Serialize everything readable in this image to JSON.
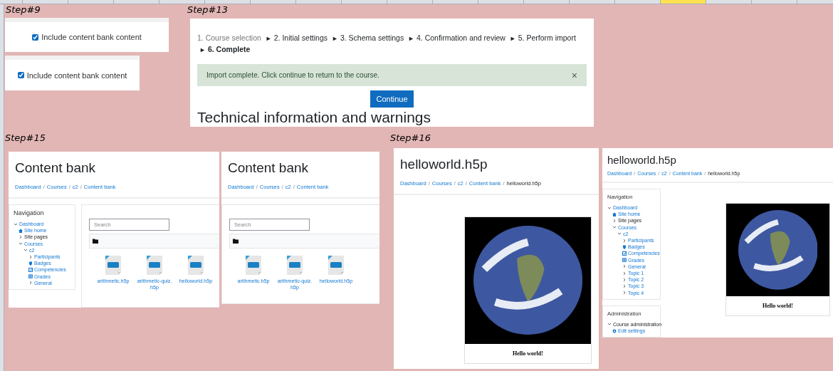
{
  "sheet": {
    "columns": [
      {
        "selected": false
      },
      {
        "selected": false
      },
      {
        "selected": false
      },
      {
        "selected": false
      },
      {
        "selected": false
      },
      {
        "selected": false
      },
      {
        "selected": false
      },
      {
        "selected": false
      },
      {
        "selected": false
      },
      {
        "selected": false
      },
      {
        "selected": false
      },
      {
        "selected": false
      },
      {
        "selected": false
      },
      {
        "selected": false
      },
      {
        "selected": false
      },
      {
        "selected": true
      },
      {
        "selected": false
      },
      {
        "selected": false
      }
    ]
  },
  "step9": {
    "label": "Step#9",
    "checkboxes": [
      {
        "label": "Include content bank content",
        "checked": true
      },
      {
        "label": "Include content bank content",
        "checked": true
      }
    ]
  },
  "step13": {
    "label": "Step#13",
    "separator": "►",
    "progress": [
      {
        "label": "1. Course selection",
        "kind": "done"
      },
      {
        "label": "2. Initial settings",
        "kind": "step"
      },
      {
        "label": "3. Schema settings",
        "kind": "step"
      },
      {
        "label": "4. Confirmation and review",
        "kind": "step"
      },
      {
        "label": "5. Perform import",
        "kind": "step"
      },
      {
        "label": "6. Complete",
        "kind": "current"
      }
    ],
    "alert": {
      "text": "Import complete. Click continue to return to the course.",
      "close": "×"
    },
    "button": "Continue",
    "heading": "Technical information and warnings"
  },
  "step15": {
    "label": "Step#15",
    "separator": "/",
    "pages": [
      {
        "title": "Content bank",
        "breadcrumb": [
          {
            "label": "Dashboard",
            "link": true
          },
          {
            "label": "Courses",
            "link": true
          },
          {
            "label": "c2",
            "link": true
          },
          {
            "label": "Content bank",
            "link": true
          }
        ],
        "navigation": {
          "title": "Navigation",
          "items": [
            {
              "label": "Dashboard",
              "kind": "branch",
              "expanded": true,
              "link": true,
              "children": [
                {
                  "label": "Site home",
                  "kind": "home",
                  "link": true
                },
                {
                  "label": "Site pages",
                  "kind": "branch",
                  "expanded": false,
                  "link": false
                },
                {
                  "label": "Courses",
                  "kind": "branch",
                  "expanded": true,
                  "link": true,
                  "children": [
                    {
                      "label": "c2",
                      "kind": "branch",
                      "expanded": true,
                      "link": true,
                      "children": [
                        {
                          "label": "Participants",
                          "kind": "branch",
                          "expanded": false,
                          "link": true
                        },
                        {
                          "label": "Badges",
                          "kind": "shield",
                          "link": true
                        },
                        {
                          "label": "Competencies",
                          "kind": "check",
                          "link": true
                        },
                        {
                          "label": "Grades",
                          "kind": "table",
                          "link": true
                        },
                        {
                          "label": "General",
                          "kind": "branch",
                          "expanded": false,
                          "link": true
                        }
                      ]
                    }
                  ]
                }
              ]
            }
          ]
        },
        "search_placeholder": "Search",
        "files": [
          "arithmetic.h5p",
          "arithmetic-quiz.h5p",
          "helloworld.h5p"
        ]
      },
      {
        "title": "Content bank",
        "breadcrumb": [
          {
            "label": "Dashboard",
            "link": true
          },
          {
            "label": "Courses",
            "link": true
          },
          {
            "label": "c2",
            "link": true
          },
          {
            "label": "Content bank",
            "link": true
          }
        ],
        "search_placeholder": "Search",
        "files": [
          "arithmetic.h5p",
          "arithmetic-quiz.h5p",
          "helloworld.h5p"
        ]
      }
    ]
  },
  "step16": {
    "label": "Step#16",
    "separator": "/",
    "pages": [
      {
        "title": "helloworld.h5p",
        "breadcrumb": [
          {
            "label": "Dashboard",
            "link": true
          },
          {
            "label": "Courses",
            "link": true
          },
          {
            "label": "c2",
            "link": true
          },
          {
            "label": "Content bank",
            "link": true
          },
          {
            "label": "helloworld.h5p",
            "link": false
          }
        ],
        "caption": "Hello world!"
      },
      {
        "title": "helloworld.h5p",
        "breadcrumb": [
          {
            "label": "Dashboard",
            "link": true
          },
          {
            "label": "Courses",
            "link": true
          },
          {
            "label": "c2",
            "link": true
          },
          {
            "label": "Content bank",
            "link": true
          },
          {
            "label": "helloworld.h5p",
            "link": false
          }
        ],
        "navigation": {
          "title": "Navigation",
          "items": [
            {
              "label": "Dashboard",
              "kind": "branch",
              "expanded": true,
              "link": true,
              "children": [
                {
                  "label": "Site home",
                  "kind": "home",
                  "link": true
                },
                {
                  "label": "Site pages",
                  "kind": "branch",
                  "expanded": false,
                  "link": false
                },
                {
                  "label": "Courses",
                  "kind": "branch",
                  "expanded": true,
                  "link": true,
                  "children": [
                    {
                      "label": "c2",
                      "kind": "branch",
                      "expanded": true,
                      "link": true,
                      "children": [
                        {
                          "label": "Participants",
                          "kind": "branch",
                          "expanded": false,
                          "link": true
                        },
                        {
                          "label": "Badges",
                          "kind": "shield",
                          "link": true
                        },
                        {
                          "label": "Competencies",
                          "kind": "check",
                          "link": true
                        },
                        {
                          "label": "Grades",
                          "kind": "table",
                          "link": true
                        },
                        {
                          "label": "General",
                          "kind": "branch",
                          "expanded": false,
                          "link": true
                        },
                        {
                          "label": "Topic 1",
                          "kind": "branch",
                          "expanded": false,
                          "link": true
                        },
                        {
                          "label": "Topic 2",
                          "kind": "branch",
                          "expanded": false,
                          "link": true
                        },
                        {
                          "label": "Topic 3",
                          "kind": "branch",
                          "expanded": false,
                          "link": true
                        },
                        {
                          "label": "Topic 4",
                          "kind": "branch",
                          "expanded": false,
                          "link": true
                        }
                      ]
                    }
                  ]
                }
              ]
            }
          ]
        },
        "administration": {
          "title": "Administration",
          "items": [
            {
              "label": "Course administration",
              "kind": "branch",
              "expanded": true,
              "link": false,
              "children": [
                {
                  "label": "Edit settings",
                  "kind": "gear",
                  "link": true
                }
              ]
            }
          ]
        },
        "caption": "Hello world!"
      }
    ]
  }
}
